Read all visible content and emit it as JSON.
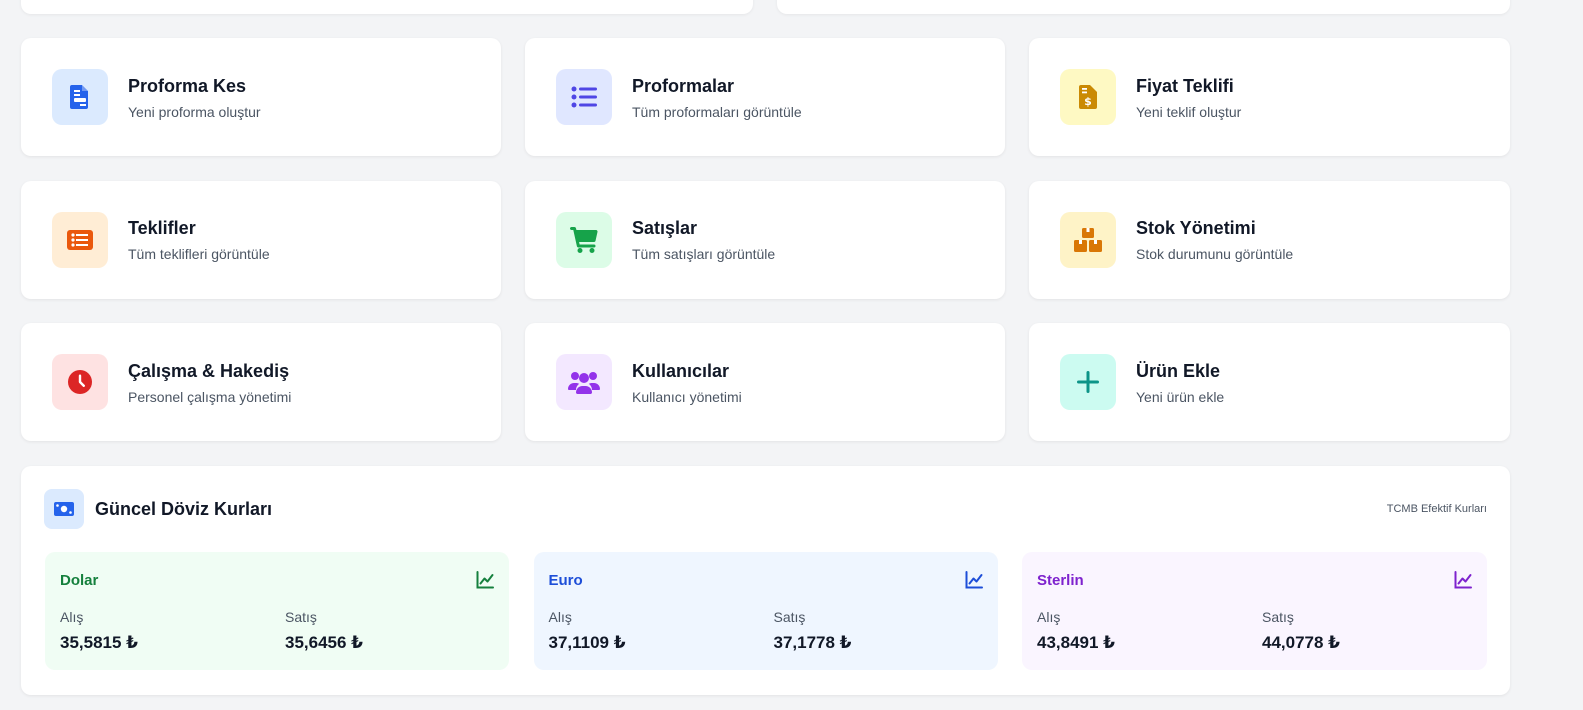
{
  "cards": [
    {
      "title": "Proforma Kes",
      "desc": "Yeni proforma oluştur",
      "icon": "file-invoice-icon",
      "bg": "#dbeafe",
      "fg": "#2563eb"
    },
    {
      "title": "Proformalar",
      "desc": "Tüm proformaları görüntüle",
      "icon": "list-icon",
      "bg": "#e0e7ff",
      "fg": "#4f46e5"
    },
    {
      "title": "Fiyat Teklifi",
      "desc": "Yeni teklif oluştur",
      "icon": "file-dollar-icon",
      "bg": "#fef9c3",
      "fg": "#ca8a04"
    },
    {
      "title": "Teklifler",
      "desc": "Tüm teklifleri görüntüle",
      "icon": "list-alt-icon",
      "bg": "#ffedd5",
      "fg": "#ea580c"
    },
    {
      "title": "Satışlar",
      "desc": "Tüm satışları görüntüle",
      "icon": "cart-icon",
      "bg": "#dcfce7",
      "fg": "#16a34a"
    },
    {
      "title": "Stok Yönetimi",
      "desc": "Stok durumunu görüntüle",
      "icon": "boxes-icon",
      "bg": "#fef3c7",
      "fg": "#d97706"
    },
    {
      "title": "Çalışma & Hakediş",
      "desc": "Personel çalışma yönetimi",
      "icon": "clock-icon",
      "bg": "#fee2e2",
      "fg": "#dc2626"
    },
    {
      "title": "Kullanıcılar",
      "desc": "Kullanıcı yönetimi",
      "icon": "users-icon",
      "bg": "#f3e8ff",
      "fg": "#9333ea"
    },
    {
      "title": "Ürün Ekle",
      "desc": "Yeni ürün ekle",
      "icon": "plus-icon",
      "bg": "#ccfbf1",
      "fg": "#0d9488"
    }
  ],
  "fx": {
    "title": "Güncel Döviz Kurları",
    "source": "TCMB Efektif Kurları",
    "icon": "money-bill-icon",
    "currencies": [
      {
        "name": "Dolar",
        "buy_label": "Alış",
        "sell_label": "Satış",
        "buy": "35,5815 ₺",
        "sell": "35,6456 ₺",
        "bg": "#f0fdf4",
        "fg": "#15803d"
      },
      {
        "name": "Euro",
        "buy_label": "Alış",
        "sell_label": "Satış",
        "buy": "37,1109 ₺",
        "sell": "37,1778 ₺",
        "bg": "#eff6ff",
        "fg": "#1d4ed8"
      },
      {
        "name": "Sterlin",
        "buy_label": "Alış",
        "sell_label": "Satış",
        "buy": "43,8491 ₺",
        "sell": "44,0778 ₺",
        "bg": "#faf5ff",
        "fg": "#7e22ce"
      }
    ]
  }
}
